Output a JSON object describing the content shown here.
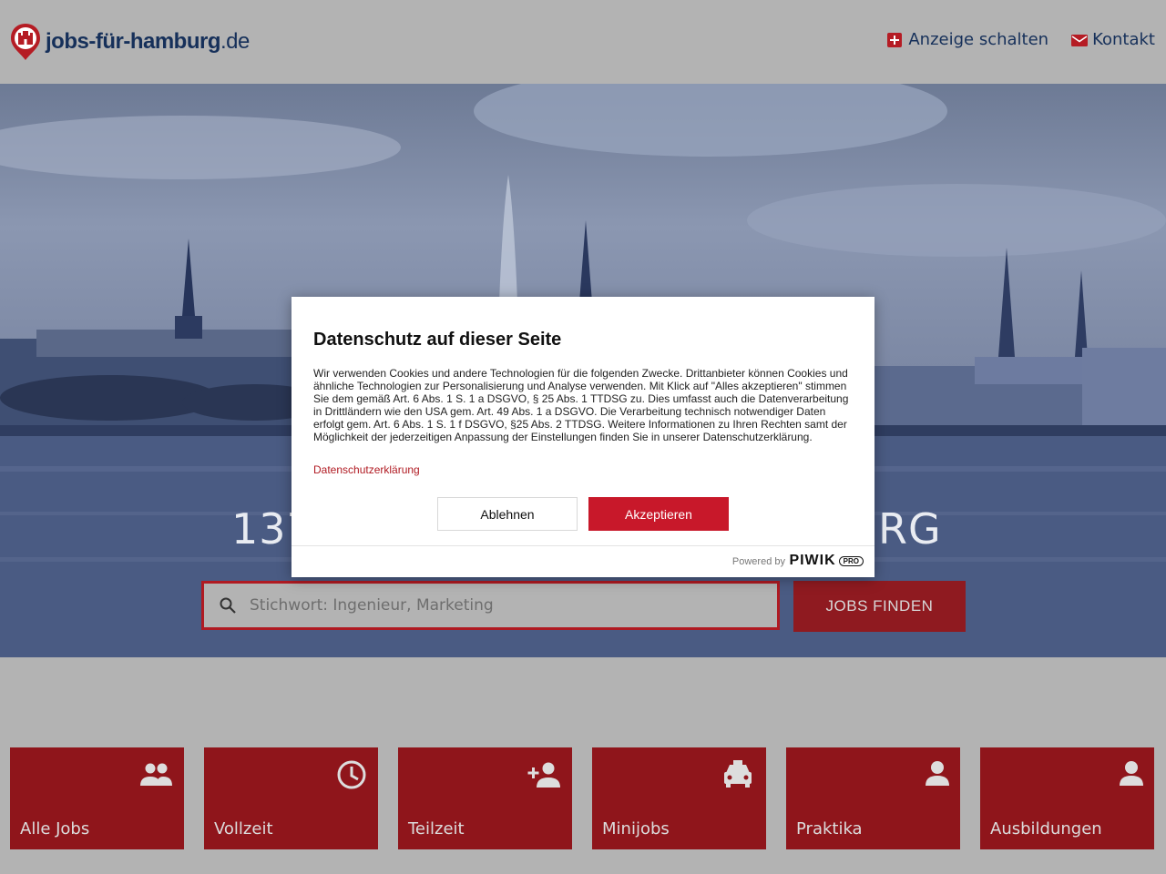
{
  "header": {
    "logo_main": "jobs-für-hamburg",
    "logo_tld": ".de",
    "nav": [
      {
        "label": "Anzeige schalten",
        "icon": "plus-box-icon"
      },
      {
        "label": "Kontakt",
        "icon": "mail-icon"
      }
    ]
  },
  "hero": {
    "title": "137",
    "title_suffix": "RG",
    "search_placeholder": "Stichwort: Ingenieur, Marketing",
    "search_button": "JOBS FINDEN"
  },
  "categories": [
    {
      "label": "Alle Jobs",
      "icon": "group-icon"
    },
    {
      "label": "Vollzeit",
      "icon": "clock-icon"
    },
    {
      "label": "Teilzeit",
      "icon": "person-add-icon"
    },
    {
      "label": "Minijobs",
      "icon": "taxi-icon"
    },
    {
      "label": "Praktika",
      "icon": "person-icon"
    },
    {
      "label": "Ausbildungen",
      "icon": "person-icon"
    }
  ],
  "consent": {
    "title": "Datenschutz auf dieser Seite",
    "text": "Wir verwenden Cookies und andere Technologien für die folgenden Zwecke. Drittanbieter können Cookies und ähnliche Technologien zur Personalisierung und Analyse verwenden. Mit Klick auf \"Alles akzeptieren\" stimmen Sie dem gemäß Art. 6 Abs. 1 S. 1 a DSGVO, § 25 Abs. 1 TTDSG zu. Dies umfasst auch die Datenverarbeitung in Drittländern wie den USA gem. Art. 49 Abs. 1 a DSGVO. Die Verarbeitung technisch notwendiger Daten erfolgt gem. Art. 6 Abs. 1 S. 1 f DSGVO, §25 Abs. 2 TTDSG. Weitere Informationen zu Ihren Rechten samt der Möglichkeit der jederzeitigen Anpassung der Einstellungen finden Sie in unserer Datenschutzerklärung.",
    "link": "Datenschutzerklärung",
    "decline": "Ablehnen",
    "accept": "Akzeptieren",
    "powered_by": "Powered by",
    "brand": "PIWIK",
    "brand_badge": "PRO"
  },
  "colors": {
    "brand_red": "#8f151b",
    "accept_red": "#c8182a",
    "navy": "#16305a"
  }
}
